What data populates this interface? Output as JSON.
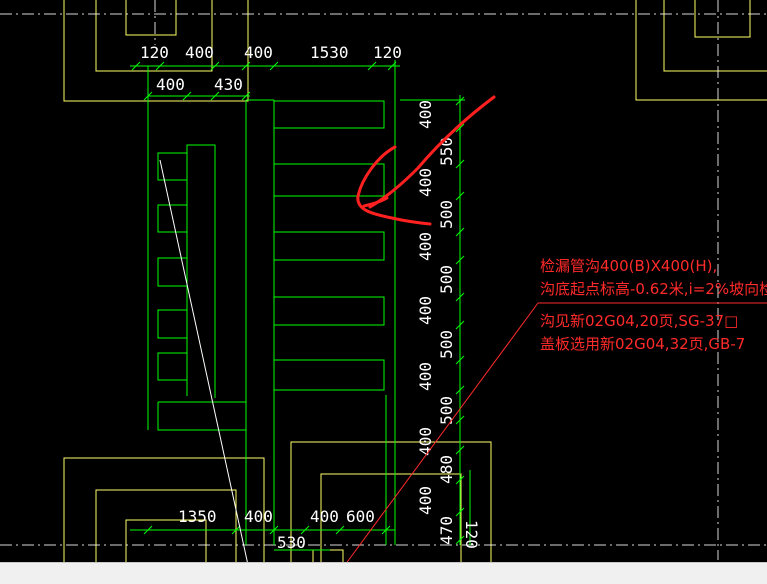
{
  "dimensions": {
    "top_row1": [
      "120",
      "400",
      "400",
      "1530",
      "120"
    ],
    "top_row2": [
      "400",
      "430"
    ],
    "right_col": [
      "400",
      "550",
      "400",
      "500",
      "400",
      "500",
      "400",
      "500",
      "400",
      "500",
      "400",
      "480",
      "400",
      "470"
    ],
    "bottom": [
      "1350",
      "400",
      "400",
      "600",
      "530",
      "120"
    ]
  },
  "annotation": {
    "line1": "检漏管沟400(B)X400(H),",
    "line2": "沟底起点标高-0.62米,i=2%坡向检漏井",
    "line3": "沟见新02G04,20页,SG-37□",
    "line4": "盖板选用新02G04,32页,GB-7"
  },
  "colors": {
    "background": "#000000",
    "trench": "#00ff00",
    "column": "#ffff66",
    "annotation": "#ff2a2a",
    "markup": "#ff2020",
    "statusbar": "#f0f0f0"
  }
}
